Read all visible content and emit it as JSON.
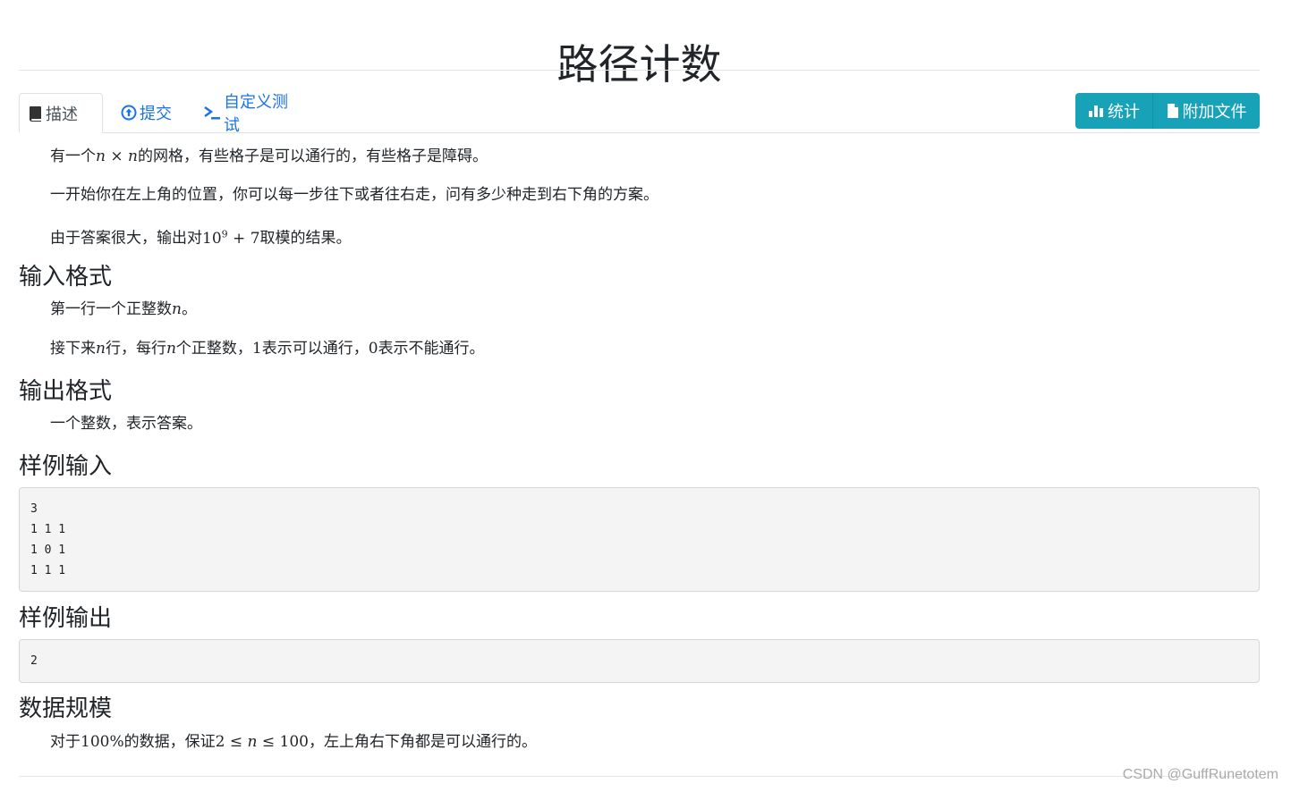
{
  "title": "路径计数",
  "tabs": [
    {
      "label": "描述",
      "icon": "book-icon",
      "active": true
    },
    {
      "label": "提交",
      "icon": "upload-circle-icon",
      "active": false
    },
    {
      "label": "自定义测试",
      "icon": "terminal-icon",
      "active": false
    }
  ],
  "actions": [
    {
      "label": "统计",
      "icon": "bar-chart-icon"
    },
    {
      "label": "附加文件",
      "icon": "file-icon"
    }
  ],
  "description": {
    "p1": {
      "pre": "有一个",
      "n1": "n",
      "times": "×",
      "n2": "n",
      "post": "的网格，有些格子是可以通行的，有些格子是障碍。"
    },
    "p2": "一开始你在左上角的位置，你可以每一步往下或者往右走，问有多少种走到右下角的方案。",
    "p3": {
      "pre": "由于答案很大，输出对",
      "base": "10",
      "exp": "9",
      "plus": "+",
      "seven": "7",
      "post": "取模的结果。"
    }
  },
  "sections": {
    "input_format": "输入格式",
    "output_format": "输出格式",
    "sample_input": "样例输入",
    "sample_output": "样例输出",
    "data_scale": "数据规模"
  },
  "input_format": {
    "p1": {
      "pre": "第一行一个正整数",
      "n": "n",
      "post": "。"
    },
    "p2": {
      "pre": "接下来",
      "n1": "n",
      "mid1": "行，每行",
      "n2": "n",
      "mid2": "个正整数，",
      "one": "1",
      "mid3": "表示可以通行，",
      "zero": "0",
      "post": "表示不能通行。"
    }
  },
  "output_format": {
    "p1": "一个整数，表示答案。"
  },
  "sample_input": "3\n1 1 1\n1 0 1\n1 1 1",
  "sample_output": "2",
  "data_scale": {
    "pre": "对于",
    "pct": "100%",
    "mid": "的数据，保证",
    "two": "2",
    "le1": "≤",
    "n": "n",
    "le2": "≤",
    "hundred": "100",
    "post": "，左上角右下角都是可以通行的。"
  },
  "watermark": "CSDN @GuffRunetotem",
  "colors": {
    "tab_link": "#1a73e8",
    "button_bg": "#17a2b8",
    "code_bg": "#f4f4f4"
  }
}
